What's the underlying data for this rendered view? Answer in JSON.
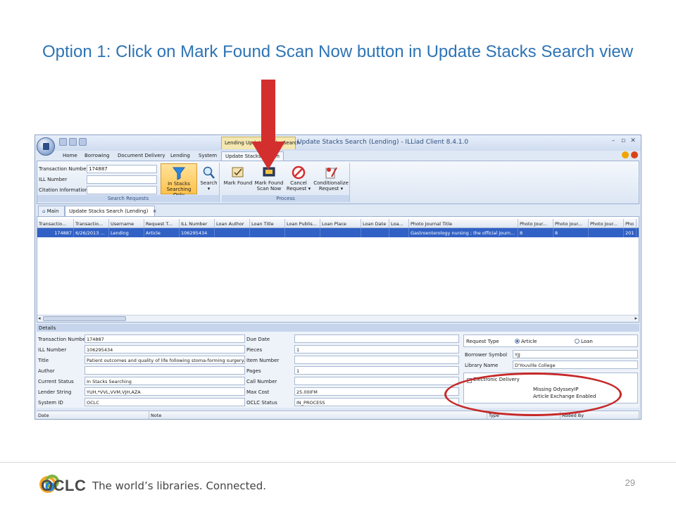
{
  "slide": {
    "title": "Option 1: Click on Mark Found Scan Now button in Update Stacks Search view",
    "page_number": "29"
  },
  "footer": {
    "brand": "OCLC",
    "tagline": "The world’s libraries. Connected."
  },
  "app": {
    "window_title": "Update Stacks Search (Lending) - ILLiad Client 8.4.1.0",
    "context_tab": "Lending Update Stacks Search",
    "ribbon_tabs": [
      "Home",
      "Borrowing",
      "Document Delivery",
      "Lending",
      "System",
      "Update Stacks Search"
    ],
    "search_fields": [
      {
        "label": "Transaction Number",
        "value": "174887"
      },
      {
        "label": "ILL Number",
        "value": ""
      },
      {
        "label": "Citation Information",
        "value": ""
      }
    ],
    "search_group_label": "Search Requests",
    "in_stacks_label_1": "In Stacks",
    "in_stacks_label_2": "Searching Only",
    "search_label": "Search",
    "process_group_label": "Process",
    "mark_found_label": "Mark Found",
    "mark_found_scan_1": "Mark Found",
    "mark_found_scan_2": "Scan Now",
    "cancel_1": "Cancel",
    "cancel_2": "Request ▾",
    "conditionalize_1": "Conditionalize",
    "conditionalize_2": "Request ▾",
    "doc_tabs": [
      "Main",
      "Update Stacks Search (Lending)"
    ],
    "doc_tab_close": "×",
    "grid_headers": [
      "Transactio...",
      "Transactio...",
      "Username",
      "Request T...",
      "ILL Number",
      "Loan Author",
      "Loan Title",
      "Loan Publis...",
      "Loan Place",
      "Loan Date",
      "Loa...",
      "Photo Journal Title",
      "Photo Jour...",
      "Photo Jour...",
      "Photo Jour...",
      "Pho"
    ],
    "grid_row": [
      "174887",
      "6/26/2013 ...",
      "Lending",
      "Article",
      "106295434",
      "",
      "",
      "",
      "",
      "",
      "",
      "Gastroenterology nursing ; the official journ...",
      "8",
      "8",
      "",
      "201"
    ],
    "details_title": "Details",
    "details_left": [
      {
        "label": "Transaction Number",
        "value": "174887"
      },
      {
        "label": "ILL Number",
        "value": "106295434"
      },
      {
        "label": "Title",
        "value": "Patient outcomes and quality of life following stoma-forming surgery."
      },
      {
        "label": "Author",
        "value": ""
      },
      {
        "label": "Current Status",
        "value": "In Stacks Searching"
      },
      {
        "label": "Lender String",
        "value": "YUH,*VVL,VVM,VJH,AZA"
      },
      {
        "label": "System ID",
        "value": "OCLC"
      }
    ],
    "details_mid": [
      {
        "label": "Due Date",
        "value": ""
      },
      {
        "label": "Pieces",
        "value": "1"
      },
      {
        "label": "Item Number",
        "value": ""
      },
      {
        "label": "Pages",
        "value": "1"
      },
      {
        "label": "Call Number",
        "value": ""
      },
      {
        "label": "Max Cost",
        "value": "25.00IFM"
      },
      {
        "label": "OCLC Status",
        "value": "IN_PROCESS"
      }
    ],
    "request_type_label": "Request Type",
    "request_type_options": [
      "Article",
      "Loan"
    ],
    "borrower_symbol_label": "Borrower Symbol",
    "borrower_symbol_value": "YJJ",
    "library_name_label": "Library Name",
    "library_name_value": "D'Youville College",
    "electronic_delivery_label": "Electronic Delivery",
    "missing_odyssey": "Missing OdysseyIP",
    "article_exchange": "Article Exchange Enabled",
    "notes_headers": [
      "Date",
      "Note",
      "Type",
      "Added By"
    ]
  },
  "colors": {
    "title_blue": "#2e74b5",
    "selected_row": "#3161c5",
    "arrow_red": "#d32f2f",
    "logo_orange": "#f5a623",
    "logo_green": "#7cb342",
    "logo_blue": "#1e88e5"
  }
}
